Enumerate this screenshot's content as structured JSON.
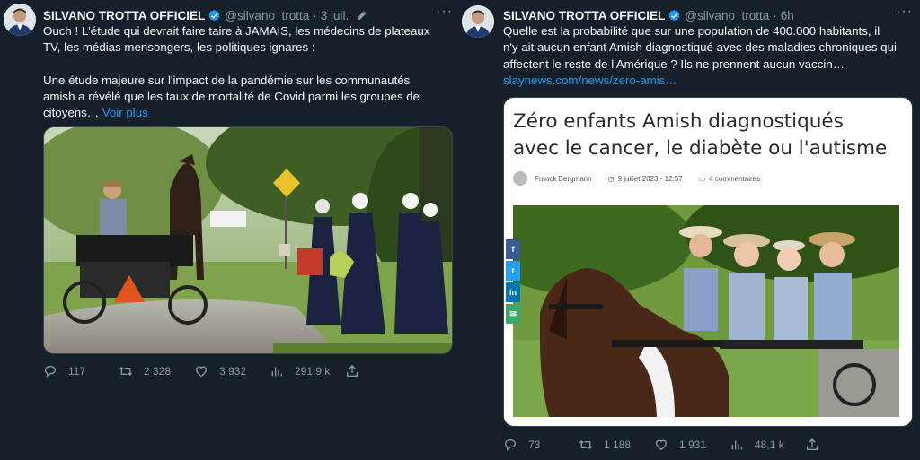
{
  "tweets": [
    {
      "author": "SILVANO TROTTA OFFICIEL",
      "handle": "@silvano_trotta",
      "time": "3 juil.",
      "text_lines": [
        "Ouch ! L'étude qui devrait faire taire à JAMAIS, les médecins de plateaux",
        "TV, les médias mensongers, les politiques ignares :",
        "",
        "Une étude majeure sur l'impact de la pandémie sur les communautés",
        "amish a révélé que les taux de mortalité de Covid parmi les groupes de"
      ],
      "last_line": "citoyens…",
      "more_link": "Voir plus",
      "stats": {
        "replies": "117",
        "retweets": "2 328",
        "likes": "3 932",
        "views": "291,9 k"
      }
    },
    {
      "author": "SILVANO TROTTA OFFICIEL",
      "handle": "@silvano_trotta",
      "time": "6h",
      "text_lines": [
        "Quelle est la probabilité que sur une population de 400.000 habitants, il",
        "n'y ait aucun enfant Amish diagnostiqué avec des maladies chroniques qui",
        "affectent le reste de l'Amérique ? Ils ne prennent aucun vaccin…"
      ],
      "link": "slaynews.com/news/zero-amis…",
      "article": {
        "title_line1": "Zéro enfants Amish diagnostiqués",
        "title_line2": "avec le cancer, le diabète ou l'autisme",
        "author": "Franck Bergmann",
        "date": "9 juillet 2023 - 12:57",
        "comments": "4 commentaires"
      },
      "stats": {
        "replies": "73",
        "retweets": "1 188",
        "likes": "1 931",
        "views": "48,1 k"
      }
    }
  ],
  "social_buttons": [
    "f",
    "t",
    "in",
    "✉"
  ],
  "colors": {
    "background": "#15202b",
    "link": "#1d9bf0",
    "muted": "#8b98a5",
    "verified": "#1d9bf0"
  },
  "icons": [
    "verified-badge-icon",
    "edit-icon",
    "more-icon",
    "reply-icon",
    "retweet-icon",
    "like-icon",
    "views-icon",
    "share-icon"
  ]
}
